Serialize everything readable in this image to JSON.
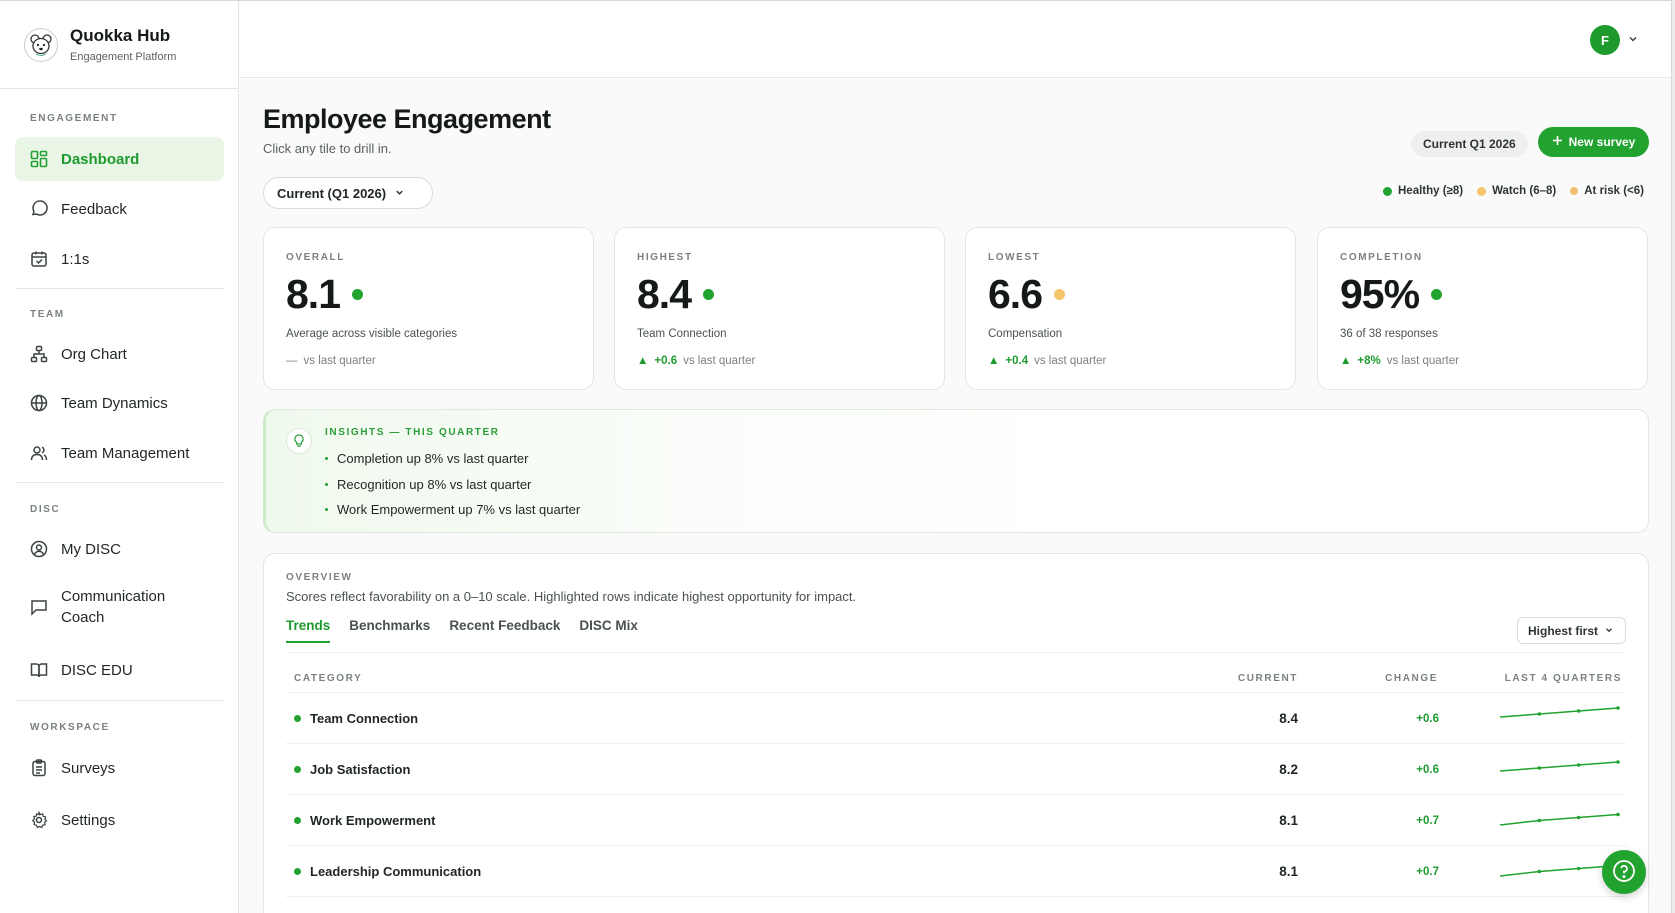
{
  "brand": {
    "name": "Quokka Hub",
    "tagline": "Engagement Platform",
    "logo_icon": "quokka-logo"
  },
  "sidebar": {
    "sections": [
      "ENGAGEMENT",
      "TEAM",
      "DISC",
      "WORKSPACE"
    ],
    "items": [
      {
        "label": "Dashboard",
        "icon": "dashboard-grid-icon",
        "active": true
      },
      {
        "label": "Feedback",
        "icon": "chat-bubble-icon"
      },
      {
        "label": "1:1s",
        "icon": "calendar-icon"
      },
      {
        "label": "Org Chart",
        "icon": "org-chart-icon"
      },
      {
        "label": "Team Dynamics",
        "icon": "globe-icon"
      },
      {
        "label": "Team Management",
        "icon": "users-icon"
      },
      {
        "label": "My DISC",
        "icon": "user-circle-icon"
      },
      {
        "label": "Communication Coach",
        "icon": "message-square-icon"
      },
      {
        "label": "DISC EDU",
        "icon": "book-open-icon"
      },
      {
        "label": "Surveys",
        "icon": "clipboard-icon"
      },
      {
        "label": "Settings",
        "icon": "gear-icon"
      }
    ]
  },
  "header": {
    "avatar_initial": "F"
  },
  "page": {
    "title": "Employee Engagement",
    "subtitle": "Click any tile to drill in.",
    "quarter_chip": "Current Q1 2026",
    "new_survey_label": "New survey",
    "period_select": "Current (Q1 2026)"
  },
  "legend": [
    {
      "label": "Healthy (≥8)",
      "color": "#22a22f"
    },
    {
      "label": "Watch (6–8)",
      "color": "#f5c56b"
    },
    {
      "label": "At risk (<6)",
      "color": "#f0c070"
    }
  ],
  "kpis": [
    {
      "label": "OVERALL",
      "value": "8.1",
      "status_color": "#22a22f",
      "desc": "Average across visible categories",
      "delta_mark": "—",
      "delta_value": "",
      "delta_text": "vs last quarter"
    },
    {
      "label": "HIGHEST",
      "value": "8.4",
      "status_color": "#22a22f",
      "desc": "Team Connection",
      "delta_mark": "▲",
      "delta_value": "+0.6",
      "delta_text": "vs last quarter"
    },
    {
      "label": "LOWEST",
      "value": "6.6",
      "status_color": "#f5c56b",
      "desc": "Compensation",
      "delta_mark": "▲",
      "delta_value": "+0.4",
      "delta_text": "vs last quarter"
    },
    {
      "label": "COMPLETION",
      "value": "95%",
      "status_color": "#22a22f",
      "desc": "36 of 38 responses",
      "delta_mark": "▲",
      "delta_value": "+8%",
      "delta_text": "vs last quarter"
    }
  ],
  "insights": {
    "title": "INSIGHTS — THIS QUARTER",
    "items": [
      "Completion up 8% vs last quarter",
      "Recognition up 8% vs last quarter",
      "Work Empowerment up 7% vs last quarter"
    ]
  },
  "overview": {
    "label": "OVERVIEW",
    "subtitle": "Scores reflect favorability on a 0–10 scale. Highlighted rows indicate highest opportunity for impact.",
    "tabs": [
      "Trends",
      "Benchmarks",
      "Recent Feedback",
      "DISC Mix"
    ],
    "active_tab": "Trends",
    "sort_label": "Highest first",
    "columns": [
      "CATEGORY",
      "CURRENT",
      "CHANGE",
      "LAST 4 QUARTERS"
    ],
    "rows": [
      {
        "category": "Team Connection",
        "current": "8.4",
        "change": "+0.6",
        "trend": [
          7.8,
          8.0,
          8.2,
          8.4
        ]
      },
      {
        "category": "Job Satisfaction",
        "current": "8.2",
        "change": "+0.6",
        "trend": [
          7.6,
          7.8,
          8.0,
          8.2
        ]
      },
      {
        "category": "Work Empowerment",
        "current": "8.1",
        "change": "+0.7",
        "trend": [
          7.4,
          7.7,
          7.9,
          8.1
        ]
      },
      {
        "category": "Leadership Communication",
        "current": "8.1",
        "change": "+0.7",
        "trend": [
          7.4,
          7.7,
          7.9,
          8.1
        ]
      }
    ]
  },
  "colors": {
    "accent": "#22a22f",
    "watch": "#f5c56b"
  }
}
